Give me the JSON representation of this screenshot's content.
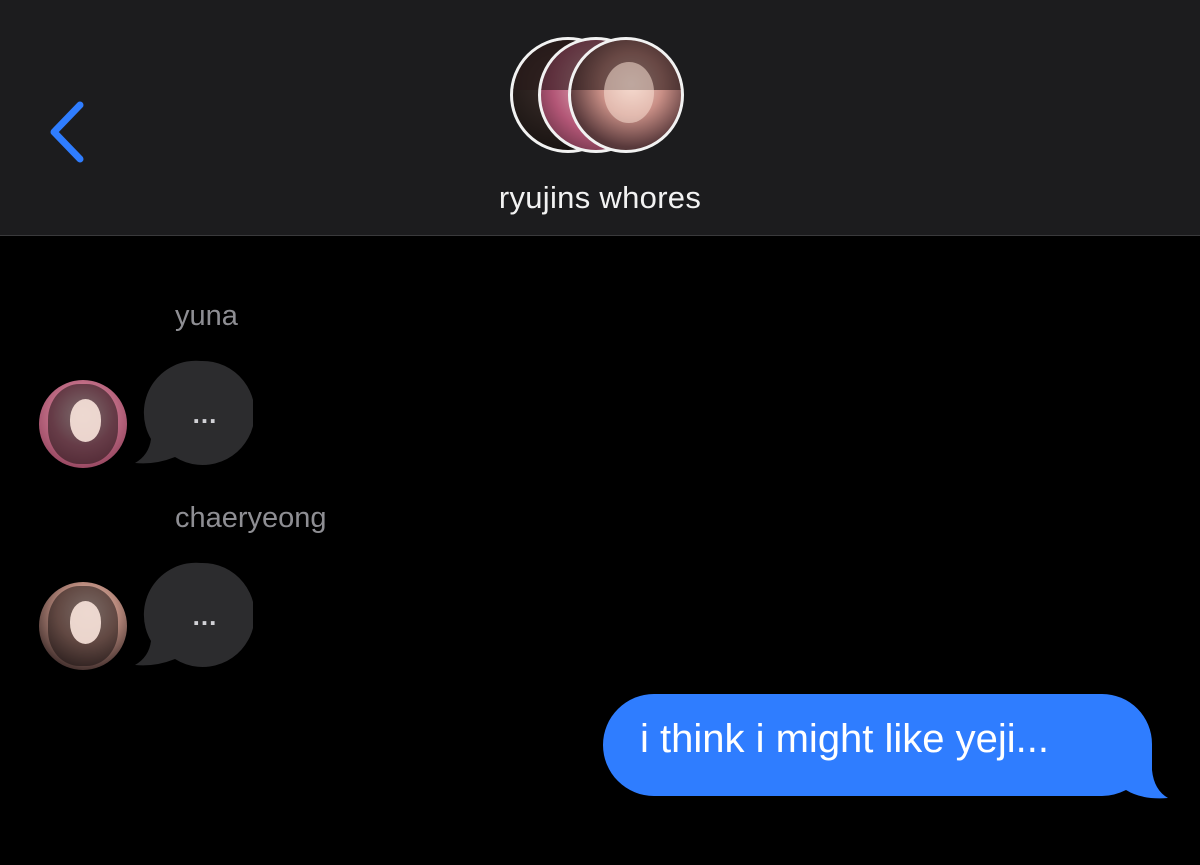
{
  "header": {
    "back_icon": "chevron-left-icon",
    "group_name": "ryujins whores",
    "accent_color": "#2f7dff"
  },
  "messages": [
    {
      "sender": "yuna",
      "type": "typing-indicator",
      "text": "..."
    },
    {
      "sender": "chaeryeong",
      "type": "typing-indicator",
      "text": "..."
    },
    {
      "sender": "me",
      "type": "outgoing",
      "text": "i think i might like yeji...",
      "bubble_color": "#2f7dff"
    }
  ],
  "colors": {
    "background": "#000000",
    "header_bg": "#1c1c1e",
    "incoming_bubble": "#2c2c2e",
    "sender_label": "#8e8e93"
  }
}
